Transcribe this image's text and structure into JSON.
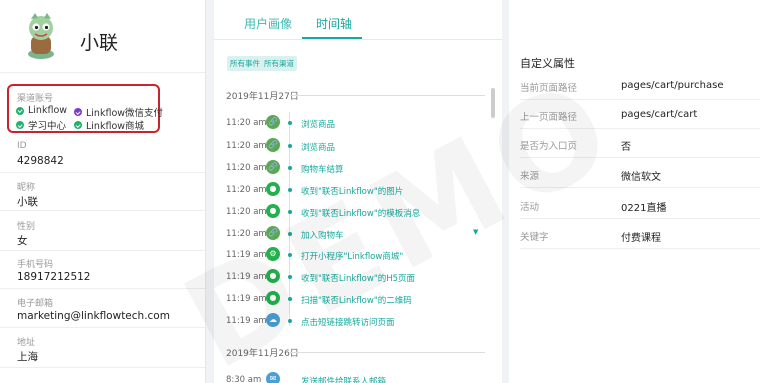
{
  "profile": {
    "name": "小联",
    "channels_title": "渠道账号",
    "channels": [
      {
        "label": "Linkflow",
        "color": "#21b26d"
      },
      {
        "label": "Linkflow微信支付",
        "color": "#7b3cc7"
      },
      {
        "label": "学习中心",
        "color": "#21b26d"
      },
      {
        "label": "Linkflow商城",
        "color": "#21b26d"
      }
    ],
    "fields": [
      {
        "label": "ID",
        "value": "4298842"
      },
      {
        "label": "昵称",
        "value": "小联"
      },
      {
        "label": "性别",
        "value": "女"
      },
      {
        "label": "手机号码",
        "value": "18917212512"
      },
      {
        "label": "电子邮箱",
        "value": "marketing@linkflowtech.com"
      },
      {
        "label": "地址",
        "value": "上海"
      }
    ]
  },
  "tabs": {
    "portrait": "用户画像",
    "timeline": "时间轴"
  },
  "filters": [
    "所有事件",
    "所有渠道"
  ],
  "timeline": {
    "date1": "2019年11月27日",
    "date2": "2019年11月26日",
    "events": [
      {
        "time": "11:20 am",
        "icon": "link-icon",
        "icon_char": "🔗",
        "color": "#5aa854",
        "label": "浏览商品"
      },
      {
        "time": "11:20 am",
        "icon": "link-icon",
        "icon_char": "🔗",
        "color": "#5aa854",
        "label": "浏览商品"
      },
      {
        "time": "11:20 am",
        "icon": "link-icon",
        "icon_char": "🔗",
        "color": "#5aa854",
        "label": "购物车结算"
      },
      {
        "time": "11:20 am",
        "icon": "wechat-icon",
        "icon_char": "●",
        "color": "#22b14c",
        "label": "收到\"联否Linkflow\"的图片"
      },
      {
        "time": "11:20 am",
        "icon": "wechat-icon",
        "icon_char": "●",
        "color": "#22b14c",
        "label": "收到\"联否Linkflow\"的模板消息"
      },
      {
        "time": "11:20 am",
        "icon": "link-icon",
        "icon_char": "🔗",
        "color": "#5aa854",
        "label": "加入购物车"
      },
      {
        "time": "11:19 am",
        "icon": "miniprogram-icon",
        "icon_char": "⚙",
        "color": "#22b14c",
        "label": "打开小程序\"Linkflow商城\""
      },
      {
        "time": "11:19 am",
        "icon": "wechat-icon",
        "icon_char": "●",
        "color": "#22b14c",
        "label": "收到\"联否Linkflow\"的H5页面"
      },
      {
        "time": "11:19 am",
        "icon": "wechat-icon",
        "icon_char": "●",
        "color": "#22b14c",
        "label": "扫描\"联否Linkflow\"的二维码"
      },
      {
        "time": "11:19 am",
        "icon": "sms-link-icon",
        "icon_char": "☁",
        "color": "#4a9fd6",
        "label": "点击短链接跳转访问页面"
      }
    ],
    "partial_time": "8:30 am",
    "partial_label": "发送邮件给联系人邮箱"
  },
  "attributes": {
    "title": "自定义属性",
    "rows": [
      {
        "key": "当前页面路径",
        "value": "pages/cart/purchase"
      },
      {
        "key": "上一页面路径",
        "value": "pages/cart/cart"
      },
      {
        "key": "是否为入口页",
        "value": "否"
      },
      {
        "key": "来源",
        "value": "微信软文"
      },
      {
        "key": "活动",
        "value": "0221直播"
      },
      {
        "key": "关键字",
        "value": "付费课程"
      }
    ]
  },
  "watermark": "DEMO",
  "colors": {
    "accent": "#16a89c",
    "highlight_border": "#c8242b"
  }
}
